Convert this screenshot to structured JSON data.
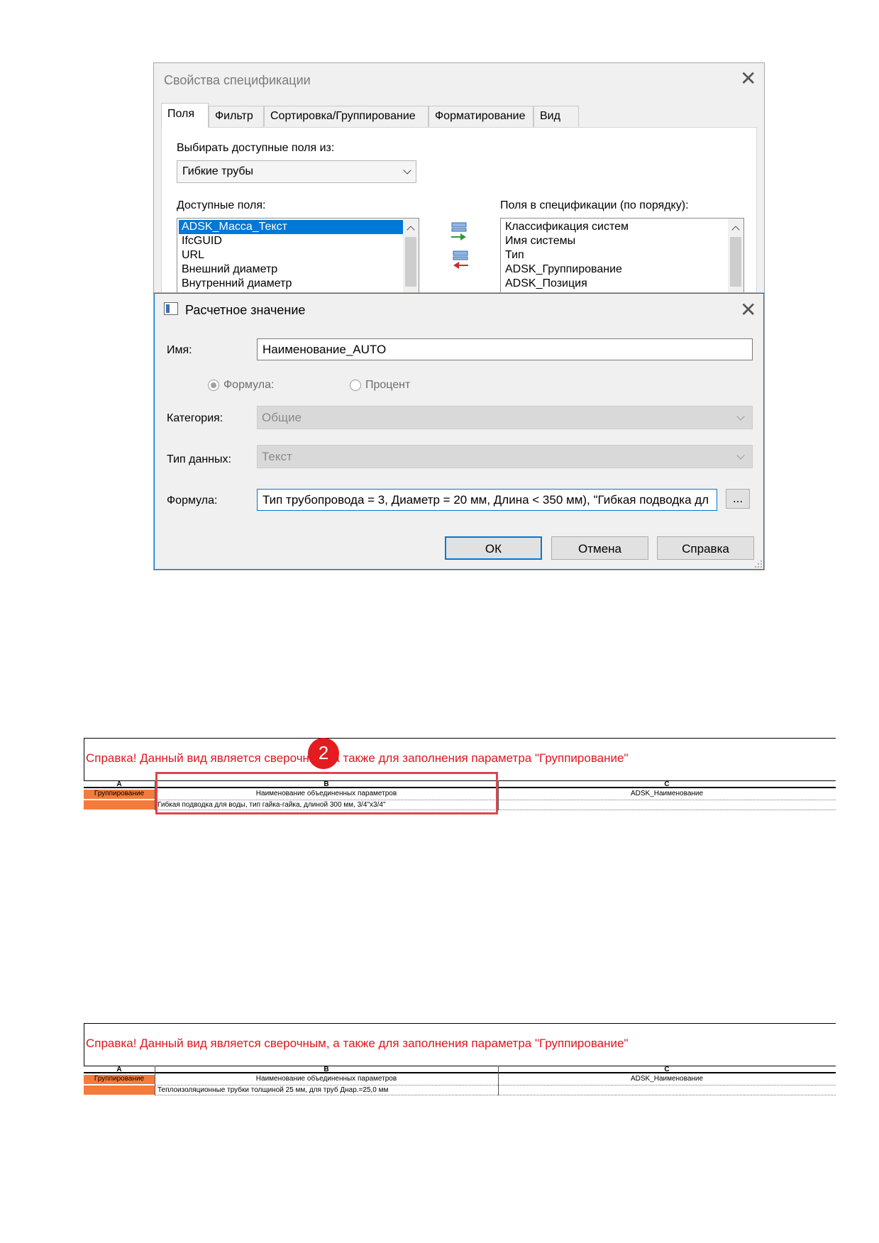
{
  "properties_dialog": {
    "title": "Свойства спецификации",
    "tabs": [
      "Поля",
      "Фильтр",
      "Сортировка/Группирование",
      "Форматирование",
      "Вид"
    ],
    "source_label": "Выбирать доступные поля из:",
    "source_value": "Гибкие трубы",
    "available_label": "Доступные поля:",
    "available_fields": [
      "ADSK_Масса_Текст",
      "IfcGUID",
      "URL",
      "Внешний диаметр",
      "Внутренний диаметр"
    ],
    "scheduled_label": "Поля в спецификации (по порядку):",
    "scheduled_fields": [
      "Классификация систем",
      "Имя системы",
      "Тип",
      "ADSK_Группирование",
      "ADSK_Позиция"
    ]
  },
  "calc_dialog": {
    "title": "Расчетное значение",
    "name_label": "Имя:",
    "name_value": "Наименование_AUTO",
    "radio_formula": "Формула:",
    "radio_percent": "Процент",
    "category_label": "Категория:",
    "category_value": "Общие",
    "datatype_label": "Тип данных:",
    "datatype_value": "Текст",
    "formula_label": "Формула:",
    "formula_value": "Тип трубопровода = 3, Диаметр = 20 мм, Длина < 350 мм), \"Гибкая подводка дл",
    "browse_label": "...",
    "ok_label": "ОК",
    "cancel_label": "Отмена",
    "help_label": "Справка"
  },
  "schedules": [
    {
      "title": "Справка! Данный вид является сверочным, а также для заполнения параметра \"Группирование\"",
      "columns": [
        "A",
        "B",
        "C"
      ],
      "header": [
        "Группирование",
        "Наименование объединенных параметров",
        "ADSK_Наименование"
      ],
      "row": "Гибкая подводка для воды, тип гайка-гайка, длиной 300 мм, 3/4\"х3/4\""
    },
    {
      "title": "Справка! Данный вид является сверочным, а также для заполнения параметра \"Группирование\"",
      "columns": [
        "A",
        "B",
        "C"
      ],
      "header": [
        "Группирование",
        "Наименование объединенных параметров",
        "ADSK_Наименование"
      ],
      "row": "Теплоизоляционные трубки толщиной 25 мм, для труб Днар.=25,0 мм"
    }
  ],
  "badge_number": "2",
  "colors": {
    "accent": "#0078d7",
    "title_red": "#e0161e",
    "highlight": "#e0454e",
    "orange": "#f47b3c"
  }
}
